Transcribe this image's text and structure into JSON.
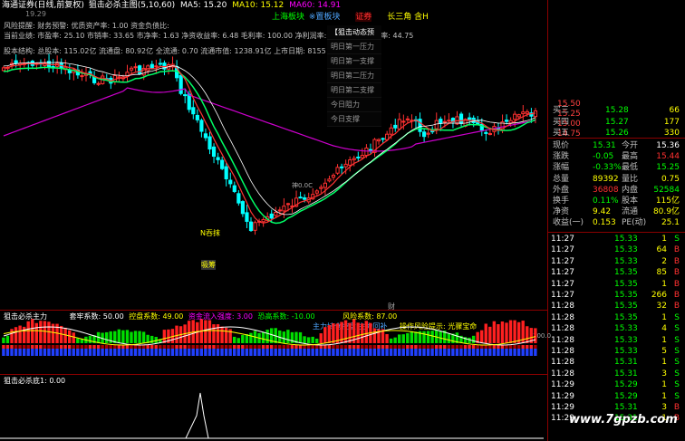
{
  "header": {
    "broker": "海通证券(日线,前复权)",
    "indicator_title": "狙击必杀主图(5,10,60)",
    "ma": [
      {
        "label": "MA5: 15.20",
        "color": "#ffffff"
      },
      {
        "label": "MA10: 15.12",
        "color": "#ffff00"
      },
      {
        "label": "MA60: 14.91",
        "color": "#ff00ff"
      }
    ],
    "right_tags": [
      {
        "label": "上海板块",
        "color": "#00ff00"
      },
      {
        "label": "※置板块",
        "color": "#4fa7ff"
      },
      {
        "label": "证券",
        "color": "#ff3030"
      },
      {
        "label": "长三角 含H",
        "color": "#ffff00"
      }
    ],
    "top_price": "19.29"
  },
  "info_lines": [
    "风险提醒: 财务预警: 优质资产率: 1.00 资金负债比: ",
    "当前业绩: 市盈率: 25.10 市销率: 33.65 市净率: 1.63 净资收益率: 6.48 毛利率: 100.00 净利润率: 33.52 主营利润率: 44.75",
    "股本结构: 总股本: 115.02亿 流通盘: 80.92亿 全流通: 0.70 流通市值: 1238.91亿 上市日期: 8155"
  ],
  "menu": {
    "items": [
      "【狙击动态预测】",
      "明日第一压力",
      "明日第一支撑",
      "明日第二压力",
      "明日第二支撑",
      "今日阻力",
      "今日支撑"
    ]
  },
  "chart_labels": {
    "buy_marker": "N吞抹",
    "buy_marker2": "吸筹",
    "annotation": "财",
    "mid_label": "神0.0C"
  },
  "right_axis": [
    "15.50",
    "15.25",
    "15.00",
    "14.75"
  ],
  "quote": {
    "asks": [
      {
        "label": "买三",
        "price": "15.28",
        "vol": "66"
      },
      {
        "label": "买四",
        "price": "15.27",
        "vol": "177"
      },
      {
        "label": "买五",
        "price": "15.26",
        "vol": "330"
      }
    ],
    "stats": [
      {
        "l1": "现价",
        "v1": "15.31",
        "l2": "今开",
        "v2": "15.36"
      },
      {
        "l1": "涨跌",
        "v1": "-0.05",
        "l2": "最高",
        "v2": "15.44"
      },
      {
        "l1": "涨幅",
        "v1": "-0.33%",
        "l2": "最低",
        "v2": "15.25"
      },
      {
        "l1": "总量",
        "v1": "89392",
        "l2": "量比",
        "v2": "0.75"
      },
      {
        "l1": "外盘",
        "v1": "36808",
        "l2": "内盘",
        "v2": "52584"
      },
      {
        "l1": "换手",
        "v1": "0.11%",
        "l2": "股本",
        "v2": "115亿"
      },
      {
        "l1": "净资",
        "v1": "9.42",
        "l2": "流通",
        "v2": "80.9亿"
      },
      {
        "l1": "收益(一)",
        "v1": "0.153",
        "l2": "PE(动)",
        "v2": "25.1"
      }
    ]
  },
  "trades": [
    {
      "time": "11:27",
      "price": "15.33",
      "vol": "1",
      "side": "S"
    },
    {
      "time": "11:27",
      "price": "15.33",
      "vol": "64",
      "side": "B"
    },
    {
      "time": "11:27",
      "price": "15.33",
      "vol": "2",
      "side": "B"
    },
    {
      "time": "11:27",
      "price": "15.35",
      "vol": "85",
      "side": "B"
    },
    {
      "time": "11:27",
      "price": "15.35",
      "vol": "1",
      "side": "B"
    },
    {
      "time": "11:27",
      "price": "15.35",
      "vol": "266",
      "side": "B"
    },
    {
      "time": "11:28",
      "price": "15.35",
      "vol": "32",
      "side": "B"
    },
    {
      "time": "11:28",
      "price": "15.35",
      "vol": "1",
      "side": "S"
    },
    {
      "time": "11:28",
      "price": "15.33",
      "vol": "4",
      "side": "S"
    },
    {
      "time": "11:28",
      "price": "15.33",
      "vol": "1",
      "side": "S"
    },
    {
      "time": "11:28",
      "price": "15.33",
      "vol": "5",
      "side": "S"
    },
    {
      "time": "11:28",
      "price": "15.31",
      "vol": "1",
      "side": "S"
    },
    {
      "time": "11:28",
      "price": "15.31",
      "vol": "3",
      "side": "S"
    },
    {
      "time": "11:29",
      "price": "15.29",
      "vol": "1",
      "side": "S"
    },
    {
      "time": "11:29",
      "price": "15.29",
      "vol": "1",
      "side": "S"
    },
    {
      "time": "11:29",
      "price": "15.31",
      "vol": "3",
      "side": "B"
    },
    {
      "time": "11:29",
      "price": "15.31",
      "vol": "1",
      "side": "B"
    }
  ],
  "indicator1": {
    "name": "狙击必杀主力",
    "params": [
      {
        "label": "套牢系数: 50.00",
        "color": "#ffffff"
      },
      {
        "label": "控盘系数: 49.00",
        "color": "#ffff00"
      },
      {
        "label": "资金流入强度: 3.00",
        "color": "#ff00ff"
      },
      {
        "label": "恐高系数: -10.00",
        "color": "#00ff00"
      },
      {
        "label": "风险系数: 87.00",
        "color": "#ffff00"
      }
    ],
    "notes": [
      {
        "label": "主力持仓控盘  主力回补",
        "color": "#4fa7ff"
      },
      {
        "label": "操作风险提示: 光骤宝命",
        "color": "#ffff00"
      }
    ],
    "axis_label": "100.0"
  },
  "indicator2": {
    "name": "狙击必杀底1: 0.00"
  },
  "watermark": "www.7gpzb.com"
}
